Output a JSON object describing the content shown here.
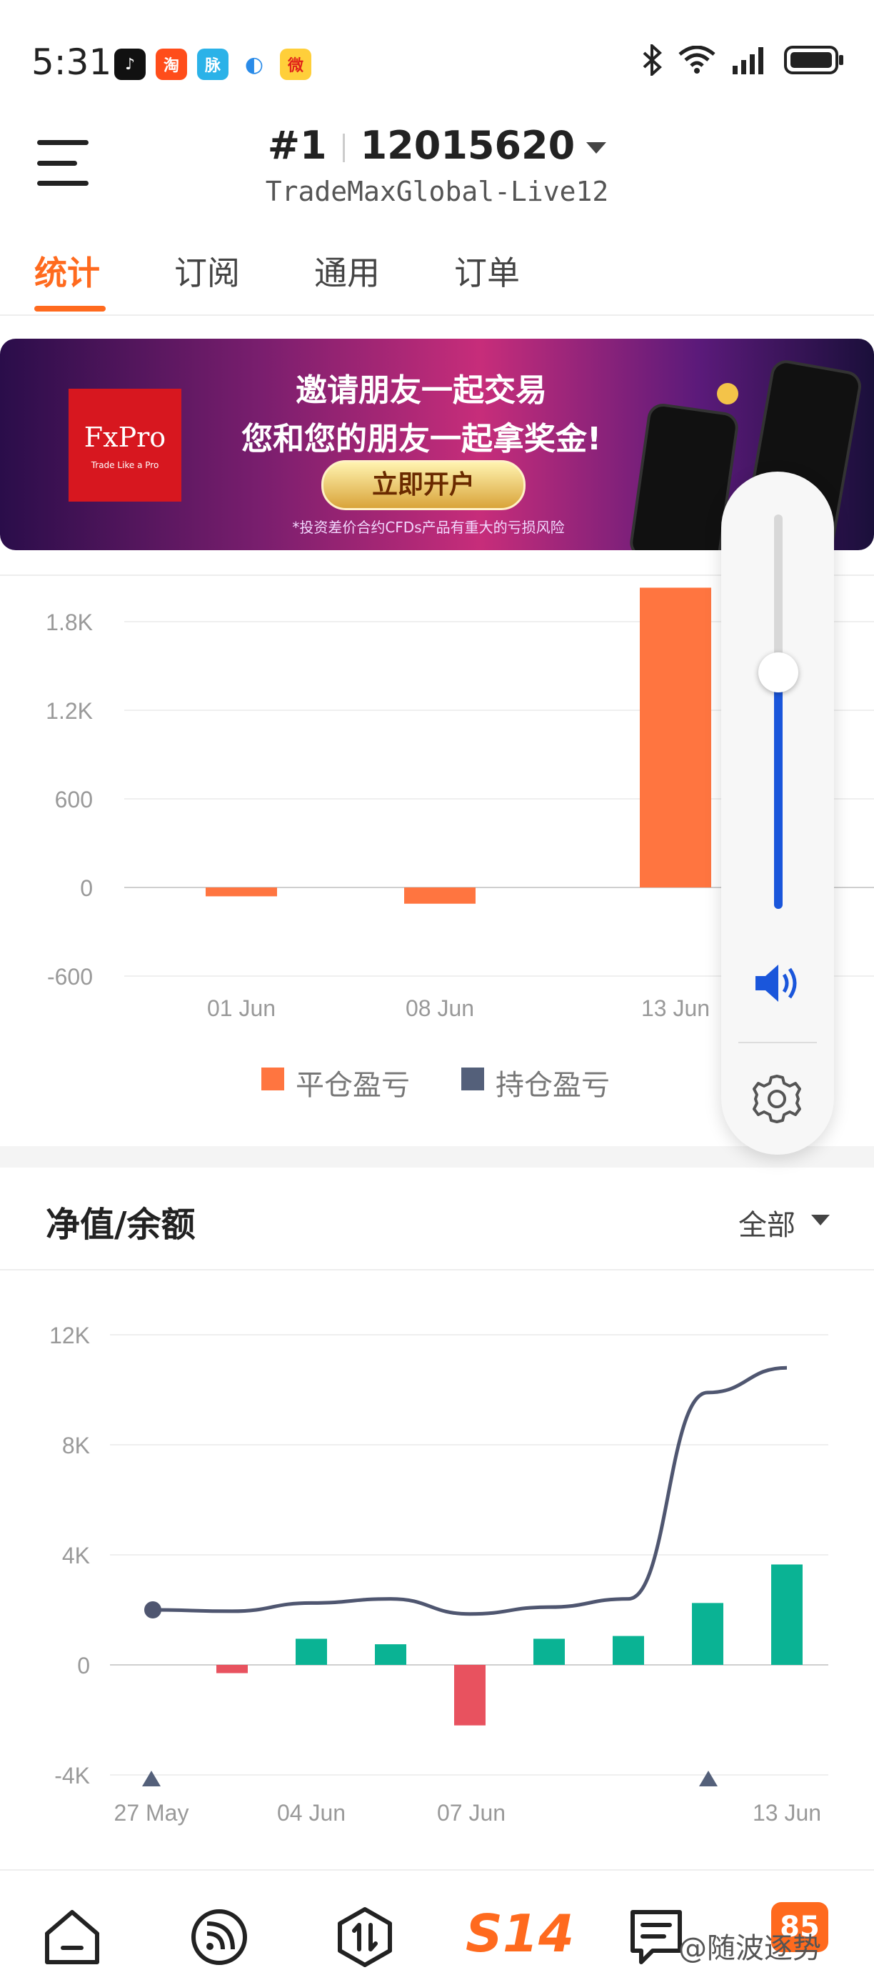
{
  "status_bar": {
    "time": "5:31",
    "apps": [
      "tiktok-icon",
      "taobao-icon",
      "app-icon",
      "browser-icon",
      "weibo-icon"
    ],
    "right_icons": [
      "bluetooth-icon",
      "wifi-icon",
      "signal-icon",
      "battery-icon"
    ]
  },
  "header": {
    "account_rank": "#1",
    "account_number": "12015620",
    "server": "TradeMaxGlobal-Live12"
  },
  "tabs": [
    {
      "label": "统计",
      "active": true
    },
    {
      "label": "订阅",
      "active": false
    },
    {
      "label": "通用",
      "active": false
    },
    {
      "label": "订单",
      "active": false
    }
  ],
  "banner": {
    "logo_text": "FxPro",
    "logo_tagline": "Trade Like a Pro",
    "line1": "邀请朋友一起交易",
    "line2": "您和您的朋友一起拿奖金!",
    "cta": "立即开户",
    "disclaimer": "*投资差价合约CFDs产品有重大的亏损风险"
  },
  "pl_chart": {
    "chart_data": {
      "type": "bar",
      "categories": [
        "01 Jun",
        "08 Jun",
        "13 Jun"
      ],
      "series": [
        {
          "name": "平仓盈亏",
          "values": [
            -60,
            -110,
            2030
          ],
          "color": "#ff7540"
        },
        {
          "name": "持仓盈亏",
          "values": [
            0,
            0,
            0
          ],
          "color": "#54607a"
        }
      ],
      "y_ticks": [
        "1.8K",
        "1.2K",
        "600",
        "0",
        "-600"
      ],
      "ylim": [
        -600,
        2100
      ],
      "legend": "bottom-center"
    }
  },
  "equity_section": {
    "title": "净值/余额",
    "filter_label": "全部",
    "chart_data": {
      "type": "bar+line",
      "x_ticks": [
        "27 May",
        "04 Jun",
        "07 Jun",
        "13 Jun"
      ],
      "y_ticks": [
        "12K",
        "8K",
        "4K",
        "0",
        "-4K"
      ],
      "ylim": [
        -4000,
        12000
      ],
      "bars": [
        0,
        -300,
        950,
        750,
        -2200,
        950,
        1050,
        2250,
        3650
      ],
      "bar_positive_color": "#0ab394",
      "bar_negative_color": "#e8525f",
      "line": [
        2000,
        1950,
        2250,
        2400,
        1850,
        2100,
        2400,
        9900,
        10800
      ],
      "line_color": "#4f5670",
      "markers": [
        "27 May",
        "12 Jun"
      ]
    }
  },
  "volume_overlay": {
    "level": 0.6,
    "speaker_icon": "speaker-icon",
    "settings_icon": "gear-icon"
  },
  "bottom_nav": {
    "items": [
      "home-icon",
      "feed-icon",
      "trade-icon",
      "s14-icon",
      "message-icon",
      "profile-icon"
    ],
    "center_label": "S14",
    "badge": "85",
    "watermark": "@随波逐势"
  }
}
